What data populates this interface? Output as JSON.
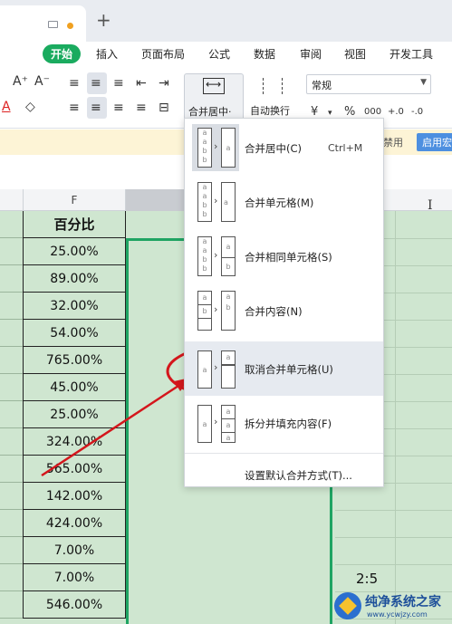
{
  "ribbon_tabs": [
    "开始",
    "插入",
    "页面布局",
    "公式",
    "数据",
    "审阅",
    "视图",
    "开发工具"
  ],
  "ribbon": {
    "merge_label": "合并居中·",
    "autowrap_label": "自动换行",
    "number_format": "常规",
    "font_grow": "A⁺",
    "font_shrink": "A⁻",
    "currency": "¥",
    "percent": "%",
    "thousands": "000",
    "inc_decimal": "+.0",
    "dec_decimal": "-.0"
  },
  "notice": {
    "disabled_text": "禁用",
    "enable_label": "启用宏"
  },
  "columns": {
    "F": "F"
  },
  "sheet": {
    "header": "百分比",
    "values": [
      "25.00%",
      "89.00%",
      "32.00%",
      "54.00%",
      "765.00%",
      "45.00%",
      "25.00%",
      "324.00%",
      "565.00%",
      "142.00%",
      "424.00%",
      "7.00%",
      "7.00%",
      "546.00%"
    ],
    "ratio": "2:5"
  },
  "menu": {
    "items": [
      {
        "label": "合并居中(C)",
        "shortcut": "Ctrl+M",
        "icon": "merge-center-icon"
      },
      {
        "label": "合并单元格(M)",
        "icon": "merge-cells-icon"
      },
      {
        "label": "合并相同单元格(S)",
        "icon": "merge-same-icon"
      },
      {
        "label": "合并内容(N)",
        "icon": "merge-content-icon"
      },
      {
        "label": "取消合并单元格(U)",
        "icon": "unmerge-icon"
      },
      {
        "label": "拆分并填充内容(F)",
        "icon": "split-fill-icon"
      }
    ],
    "settings": "设置默认合并方式(T)..."
  },
  "watermark": {
    "title": "纯净系统之家",
    "url": "www.ycwjzy.com"
  },
  "colors": {
    "accent_green": "#1aab5f",
    "annotation_red": "#d4161c",
    "sheet_green": "#cfe6d0"
  }
}
